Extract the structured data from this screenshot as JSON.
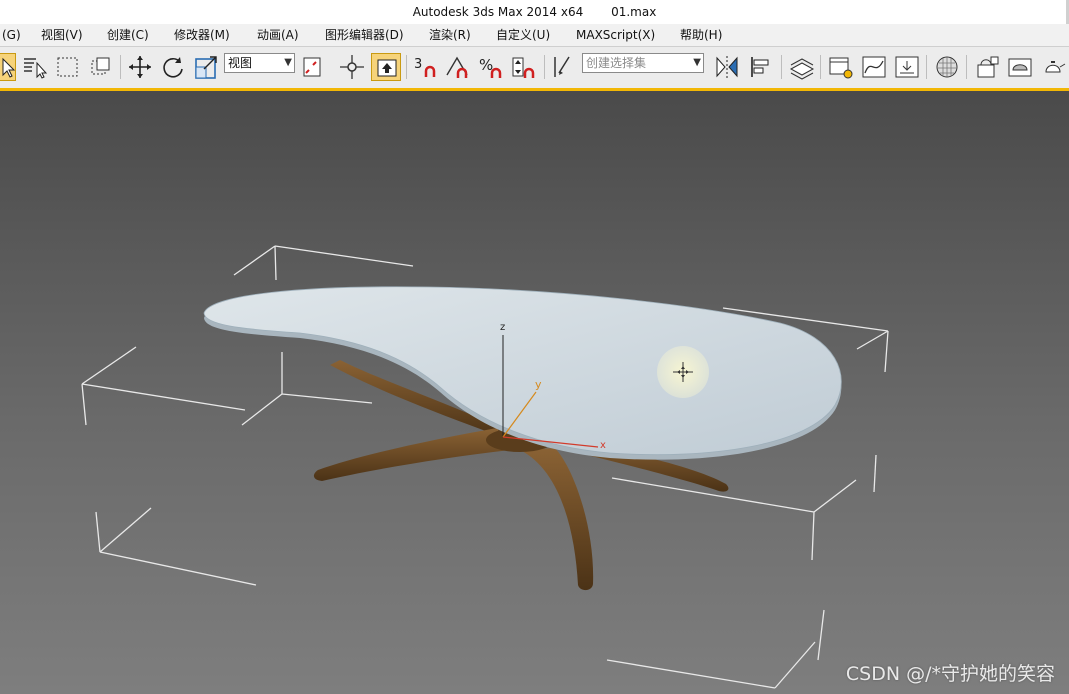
{
  "window": {
    "app_title": "Autodesk 3ds Max  2014 x64",
    "file_name": "01.max"
  },
  "menu": {
    "items": [
      "(G)",
      "视图(V)",
      "创建(C)",
      "修改器(M)",
      "动画(A)",
      "图形编辑器(D)",
      "渲染(R)",
      "自定义(U)",
      "MAXScript(X)",
      "帮助(H)"
    ]
  },
  "toolbar": {
    "coord_system": "视图",
    "selection_set_placeholder": "创建选择集",
    "snap_angle_label": "3",
    "percent_label": "%"
  },
  "viewport": {
    "axis_labels": {
      "z": "z",
      "y": "y",
      "x": "x"
    },
    "colors": {
      "table_top": "#c9d5dd",
      "wood": "#6b4a27",
      "bounding_box": "#e8e8e8",
      "axis_x": "#d23b2b",
      "axis_y": "#d58a1e",
      "axis_z": "#222222"
    }
  },
  "watermark": "CSDN @/*守护她的笑容"
}
